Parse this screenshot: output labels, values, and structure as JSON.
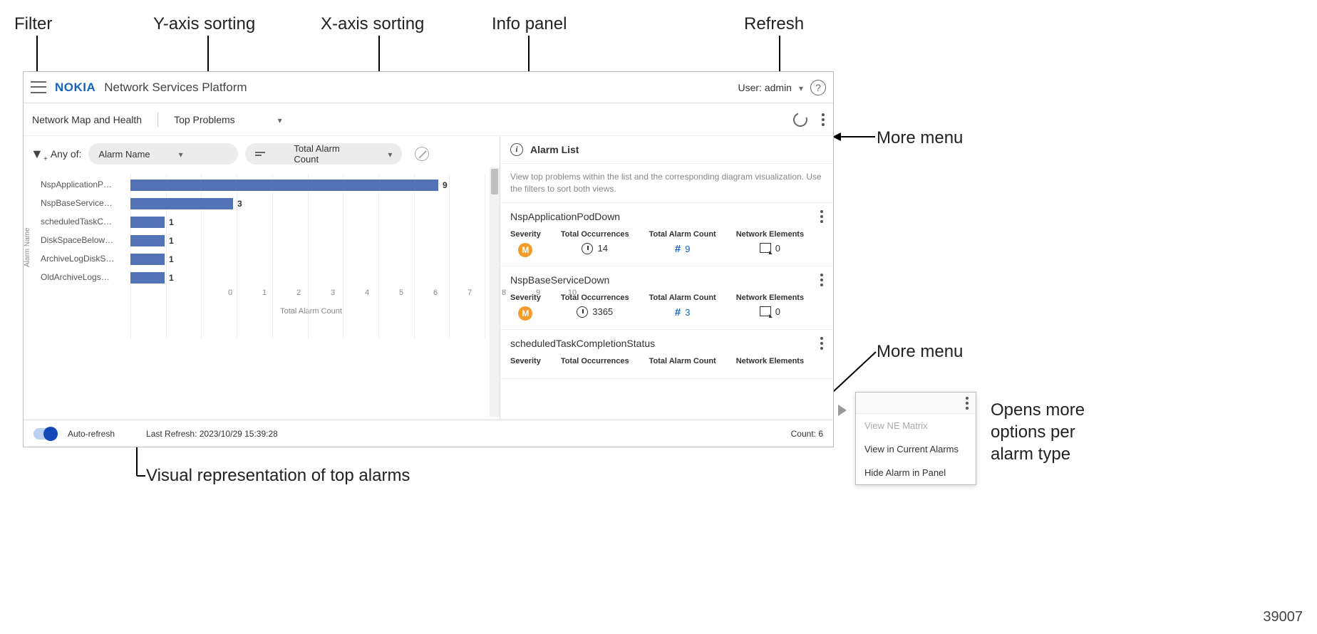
{
  "callouts": {
    "filter": "Filter",
    "ysort": "Y-axis sorting",
    "xsort": "X-axis sorting",
    "infopanel": "Info panel",
    "refresh": "Refresh",
    "moremenu1": "More menu",
    "moremenu2": "More menu",
    "visual": "Visual representation of top alarms",
    "opens": "Opens more options per alarm type"
  },
  "topbar": {
    "logo": "NOKIA",
    "title": "Network Services Platform",
    "user_label": "User: admin"
  },
  "subbar": {
    "crumb": "Network Map and Health",
    "view": "Top Problems"
  },
  "filter_row": {
    "anyof": "Any of:",
    "pill_y": "Alarm Name",
    "pill_x": "Total Alarm Count"
  },
  "chart_data": {
    "type": "bar",
    "orientation": "horizontal",
    "categories": [
      "NspApplicationP…",
      "NspBaseService…",
      "scheduledTaskC…",
      "DiskSpaceBelow…",
      "ArchiveLogDiskS…",
      "OldArchiveLogs…"
    ],
    "values": [
      9,
      3,
      1,
      1,
      1,
      1
    ],
    "xlabel": "Total Alarm Count",
    "ylabel": "Alarm Name",
    "xlim": [
      0,
      10
    ],
    "xticks": [
      0,
      1,
      2,
      3,
      4,
      5,
      6,
      7,
      8,
      9,
      10
    ]
  },
  "info": {
    "title": "Alarm List",
    "desc": "View top problems within the list and the corresponding diagram visualization. Use the filters to sort both views.",
    "metric_labels": {
      "severity": "Severity",
      "occurrences": "Total Occurrences",
      "alarm_count": "Total Alarm Count",
      "ne": "Network Elements"
    },
    "items": [
      {
        "name": "NspApplicationPodDown",
        "severity": "M",
        "occurrences": 14,
        "alarm_count": 9,
        "ne": 0
      },
      {
        "name": "NspBaseServiceDown",
        "severity": "M",
        "occurrences": 3365,
        "alarm_count": 3,
        "ne": 0
      },
      {
        "name": "scheduledTaskCompletionStatus",
        "severity": "",
        "occurrences": "",
        "alarm_count": "",
        "ne": ""
      }
    ]
  },
  "footer": {
    "auto_refresh": "Auto-refresh",
    "last_refresh": "Last Refresh: 2023/10/29 15:39:28",
    "count": "Count: 6"
  },
  "pop_menu": {
    "item1": "View NE Matrix",
    "item2": "View in Current Alarms",
    "item3": "Hide Alarm in Panel"
  },
  "page_number": "39007"
}
